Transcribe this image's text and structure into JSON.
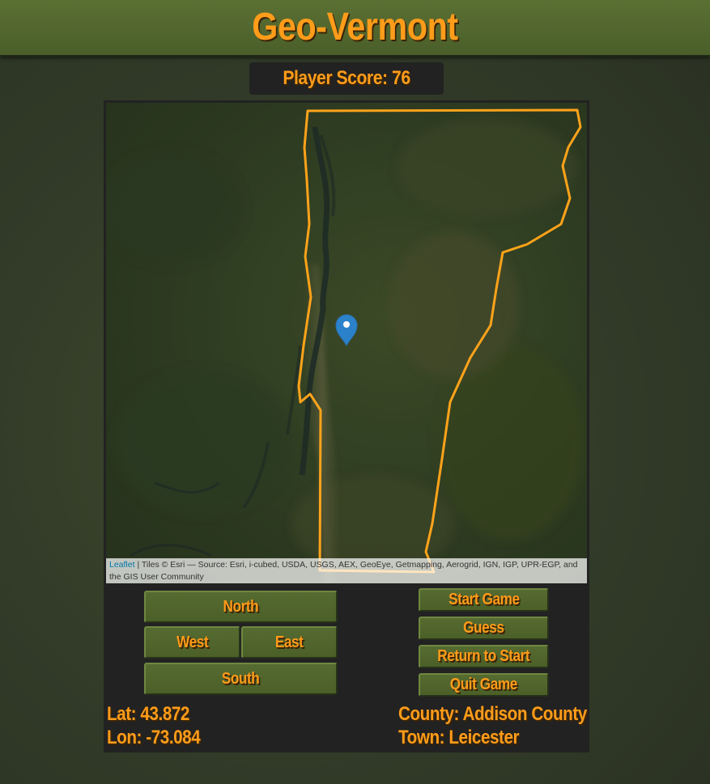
{
  "title": "Geo-Vermont",
  "score_label": "Player Score: 76",
  "map": {
    "attribution_link": "Leaflet",
    "attribution_text": "| Tiles © Esri — Source: Esri, i-cubed, USDA, USGS, AEX, GeoEye, Getmapping, Aerogrid, IGN, IGP, UPR-EGP, and the GIS User Community",
    "outline_color": "#ffa31a",
    "marker_color": "#2b82cb"
  },
  "nav": {
    "north": "North",
    "west": "West",
    "east": "East",
    "south": "South"
  },
  "actions": {
    "start": "Start Game",
    "guess": "Guess",
    "return": "Return to Start",
    "quit": "Quit Game"
  },
  "info": {
    "lat": "Lat: 43.872",
    "lon": "Lon: -73.084",
    "county": "County: Addison County",
    "town": "Town: Leicester"
  },
  "colors": {
    "accent_text": "#ff9c1a",
    "button_green": "#4f632b",
    "panel_dark": "#222222"
  }
}
